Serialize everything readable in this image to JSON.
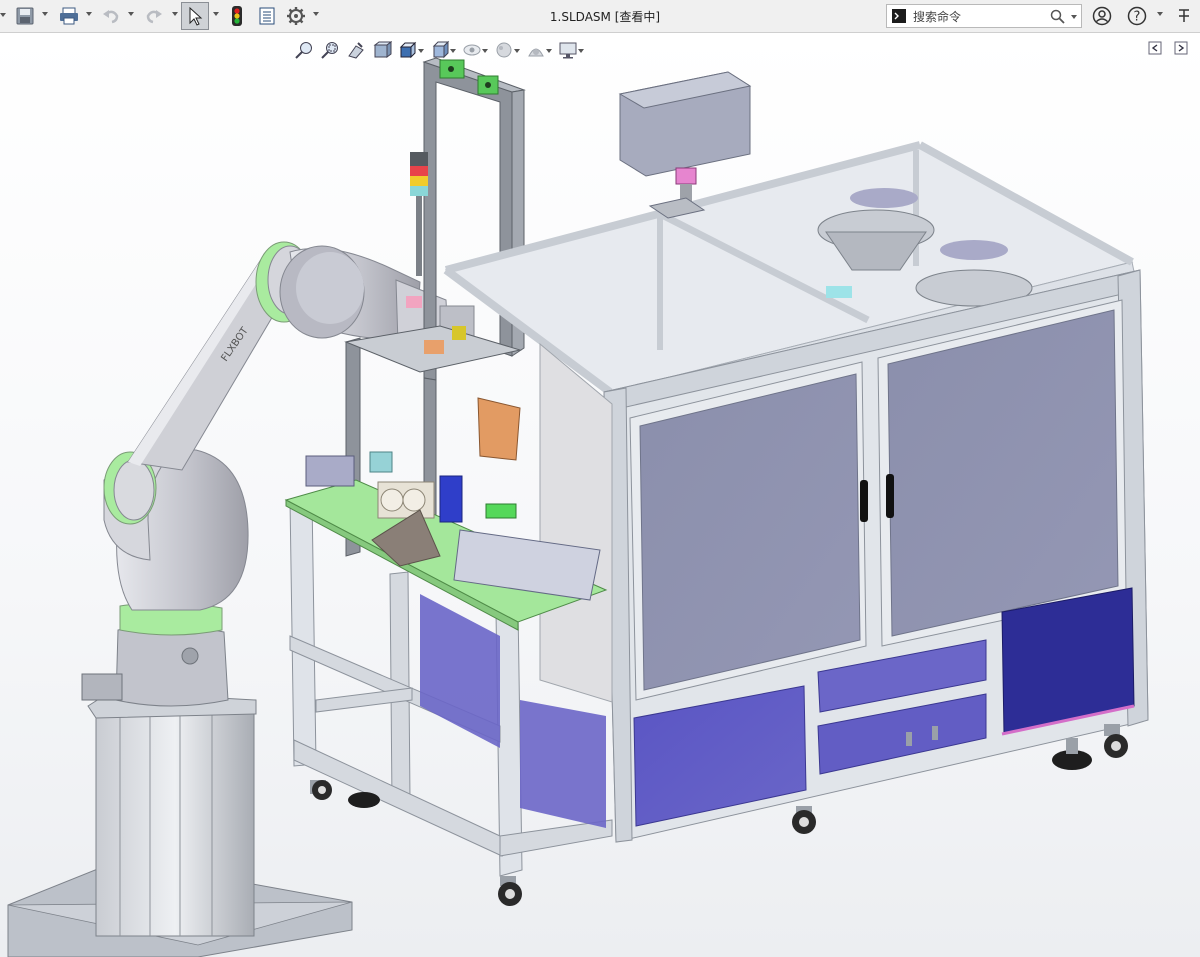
{
  "window": {
    "title": "1.SLDASM [查看中]"
  },
  "toolbar": {
    "icons": [
      "save-icon",
      "print-icon",
      "undo-icon",
      "redo-icon",
      "select-arrow-icon",
      "rebuild-traffic-light-icon",
      "file-properties-icon",
      "options-gear-icon"
    ]
  },
  "search": {
    "placeholder": "搜索命令"
  },
  "right_icons": [
    "user-account-icon",
    "help-icon",
    "pin-icon"
  ],
  "heads_up_view": {
    "icons": [
      "zoom-to-fit-icon",
      "zoom-to-area-icon",
      "previous-view-icon",
      "section-view-icon",
      "view-orientation-icon",
      "display-style-icon",
      "hide-show-items-icon",
      "edit-appearance-icon",
      "apply-scene-icon",
      "view-settings-icon"
    ]
  },
  "model": {
    "robot_brand_label": "FLXBOT",
    "colors": {
      "frame": "#dfe3ea",
      "frame_edge": "#8d939c",
      "glass": "#e4e8ee",
      "door_panel": "#8a8fae",
      "blue_panel": "#5d59c2",
      "deep_blue_panel": "#2c2c94",
      "green_plate": "#a4e79b",
      "robot_body": "#c9cad1",
      "robot_ring": "#a9eb9f",
      "base_plate": "#bcc1c9"
    }
  }
}
